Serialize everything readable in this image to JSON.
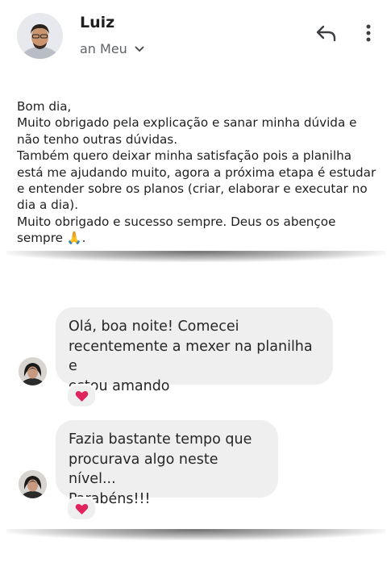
{
  "email": {
    "sender_name": "Luiz",
    "recipient_label": "an Meu",
    "body_lines": [
      "Bom dia,",
      "Muito obrigado pela explicação e sanar minha dúvida e não tenho outras dúvidas.",
      "Também quero deixar minha satisfação pois a planilha está me ajudando muito, agora a próxima etapa é estudar e entender sobre os planos (criar, elaborar e executar no dia a dia).",
      "Muito obrigado e sucesso sempre. Deus os abençoe sempre 🙏."
    ],
    "icons": {
      "reply": "reply-icon",
      "more": "more-vert-icon",
      "expand": "chevron-down-icon"
    }
  },
  "chat": {
    "messages": [
      {
        "lines": [
          "Olá, boa noite! Comecei",
          "recentemente a mexer na planilha e",
          "estou amando"
        ],
        "reaction": "❤️"
      },
      {
        "lines": [
          "Fazia bastante tempo que",
          "procurava algo neste nível...",
          "Parabéns!!!"
        ],
        "reaction": "❤️"
      }
    ]
  },
  "colors": {
    "bubble_bg": "#efeff0",
    "text": "#1f1f1f",
    "secondary_text": "#5f6368",
    "heart": "#e0245e"
  }
}
